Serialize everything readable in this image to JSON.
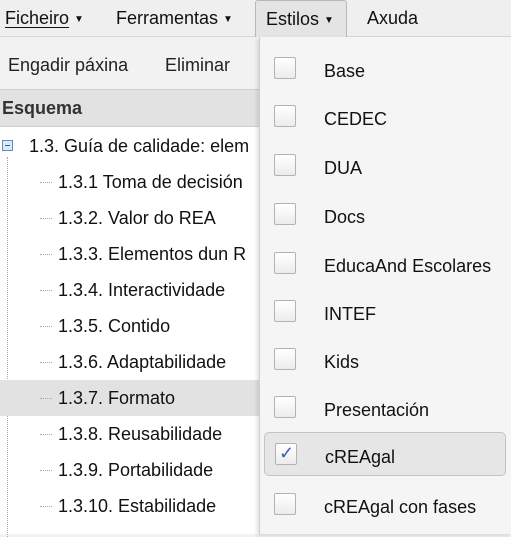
{
  "menubar": {
    "items": [
      {
        "label": "Ficheiro",
        "has_caret": true
      },
      {
        "label": "Ferramentas",
        "has_caret": true
      },
      {
        "label": "Estilos",
        "has_caret": true
      },
      {
        "label": "Axuda",
        "has_caret": false
      }
    ],
    "open_menu": "Estilos"
  },
  "toolbar": {
    "add_page_label": "Engadir páxina",
    "delete_label": "Eliminar"
  },
  "outline": {
    "title": "Esquema",
    "root": {
      "label": "1.3. Guía de calidade: elem"
    },
    "children": [
      {
        "label": "1.3.1 Toma de decisión"
      },
      {
        "label": "1.3.2. Valor do REA"
      },
      {
        "label": "1.3.3. Elementos dun R"
      },
      {
        "label": "1.3.4. Interactividade"
      },
      {
        "label": "1.3.5. Contido"
      },
      {
        "label": "1.3.6. Adaptabilidade"
      },
      {
        "label": "1.3.7. Formato"
      },
      {
        "label": "1.3.8. Reusabilidade"
      },
      {
        "label": "1.3.9. Portabilidade"
      },
      {
        "label": "1.3.10. Estabilidade"
      }
    ],
    "selected_index": 6
  },
  "styles_menu": {
    "items": [
      {
        "label": "Base",
        "checked": false
      },
      {
        "label": "CEDEC",
        "checked": false
      },
      {
        "label": "DUA",
        "checked": false
      },
      {
        "label": "Docs",
        "checked": false
      },
      {
        "label": "EducaAnd Escolares",
        "checked": false
      },
      {
        "label": "INTEF",
        "checked": false
      },
      {
        "label": "Kids",
        "checked": false
      },
      {
        "label": "Presentación",
        "checked": false
      },
      {
        "label": "cREAgal",
        "checked": true
      },
      {
        "label": "cREAgal con fases",
        "checked": false
      }
    ],
    "check_color": "#3a5fb8"
  }
}
